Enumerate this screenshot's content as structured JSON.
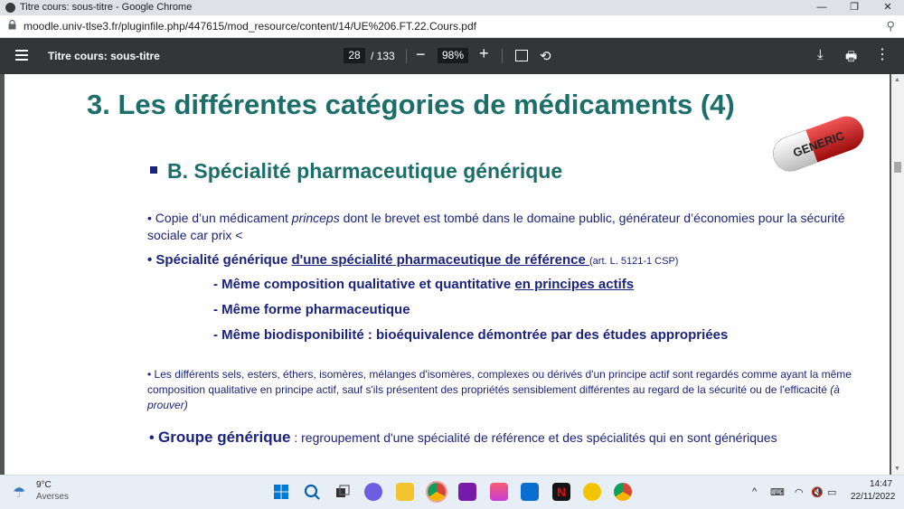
{
  "window": {
    "title": "Titre cours: sous-titre - Google Chrome"
  },
  "address": {
    "url": "moodle.univ-tlse3.fr/pluginfile.php/447615/mod_resource/content/14/UE%206.FT.22.Cours.pdf"
  },
  "pdf_toolbar": {
    "doc_title": "Titre cours: sous-titre",
    "page_current": "28",
    "page_total": "/ 133",
    "zoom": "98%",
    "zoom_minus": "−",
    "zoom_plus": "+"
  },
  "slide": {
    "title": "3. Les différentes catégories de  médicaments (4)",
    "pill_label": "GENERIC",
    "subtitle": "B. Spécialité pharmaceutique générique",
    "p1_a": "Copie d’un médicament ",
    "p1_b": "princeps",
    "p1_c": " dont le brevet est tombé dans le domaine public, générateur d’économies pour la sécurité sociale car prix <",
    "p2_a": "Spécialité générique ",
    "p2_b": "d'une spécialité pharmaceutique de référence ",
    "p2_c": "(art. L. 5121-1 CSP)",
    "d1_a": "- Même composition qualitative et quantitative ",
    "d1_b": "en principes actifs",
    "d2": "- Même forme pharmaceutique",
    "d3": "- Même biodisponibilité : bioéquivalence démontrée par des études appropriées",
    "p3_a": "Les différents sels, esters, éthers, isomères, mélanges d'isomères, complexes ou dérivés d'un principe actif sont regardés comme ayant la même composition qualitative en principe actif, sauf s'ils présentent des propriétés sensiblement différentes au regard de la sécurité ou de l'efficacité ",
    "p3_b": "(à prouver)",
    "p4_a": "Groupe générique",
    "p4_b": " : regroupement d'une spécialité de référence et des spécialités qui en sont génériques"
  },
  "taskbar": {
    "weather_temp": "9°C",
    "weather_desc": "Averses",
    "time": "14:47",
    "date": "22/11/2022"
  },
  "colors": {
    "title": "#1b6e6a",
    "text": "#1a237e",
    "toolbar": "#323639"
  }
}
